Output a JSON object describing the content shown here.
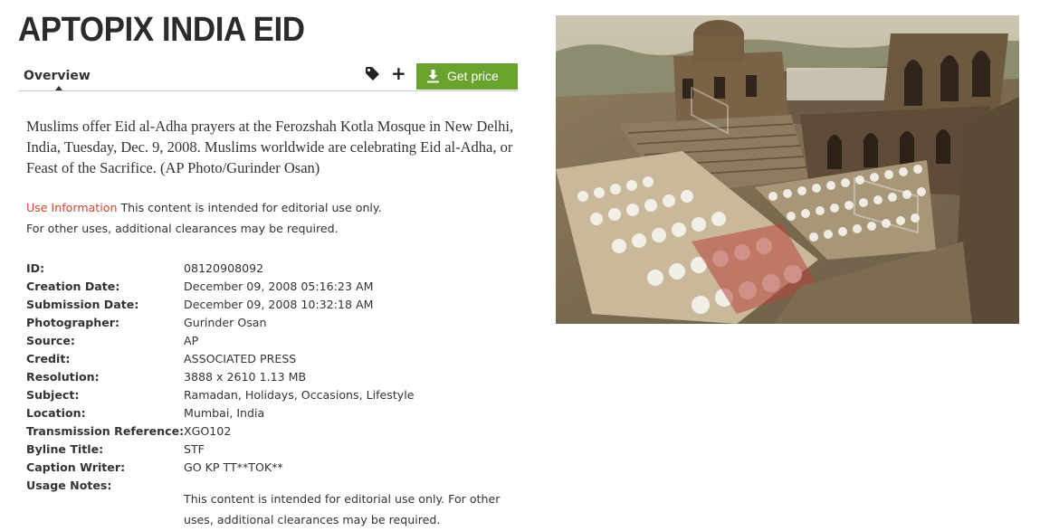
{
  "title": "APTOPIX INDIA EID",
  "tabs": {
    "overview": "Overview"
  },
  "actions": {
    "tag_icon": "tag-icon",
    "plus_icon": "plus-icon",
    "plus_glyph": "+",
    "get_price": "Get price",
    "download_icon": "download-icon"
  },
  "caption": "Muslims offer Eid al-Adha prayers at the Ferozshah Kotla Mosque in New Delhi, India, Tuesday, Dec. 9, 2008. Muslims worldwide are celebrating Eid al-Adha, or Feast of the Sacrifice. (AP Photo/Gurinder Osan)",
  "use_information": {
    "link": "Use Information",
    "text_1": " This content is intended for editorial use only.",
    "text_2": "For other uses, additional clearances may be required."
  },
  "metadata": [
    {
      "label": "ID:",
      "value": "08120908092"
    },
    {
      "label": "Creation Date:",
      "value": "December 09, 2008 05:16:23 AM"
    },
    {
      "label": "Submission Date:",
      "value": "December 09, 2008 10:32:18 AM"
    },
    {
      "label": "Photographer:",
      "value": "Gurinder Osan"
    },
    {
      "label": "Source:",
      "value": "AP"
    },
    {
      "label": "Credit:",
      "value": "ASSOCIATED PRESS"
    },
    {
      "label": "Resolution:",
      "value": "3888 x 2610 1.13 MB"
    },
    {
      "label": "Subject:",
      "value": "Ramadan, Holidays, Occasions, Lifestyle"
    },
    {
      "label": "Location:",
      "value": "Mumbai, India"
    },
    {
      "label": "Transmission Reference:",
      "value": "XGO102"
    },
    {
      "label": "Byline Title:",
      "value": "STF"
    },
    {
      "label": "Caption Writer:",
      "value": "GO KP TT**TOK**"
    },
    {
      "label": "Usage Notes:",
      "value": ""
    }
  ],
  "usage_notes": "This content is intended for editorial use only. For other uses, additional clearances may be required.",
  "colors": {
    "accent_green": "#6aa22e",
    "link_red": "#d9432f",
    "text": "#333333"
  }
}
